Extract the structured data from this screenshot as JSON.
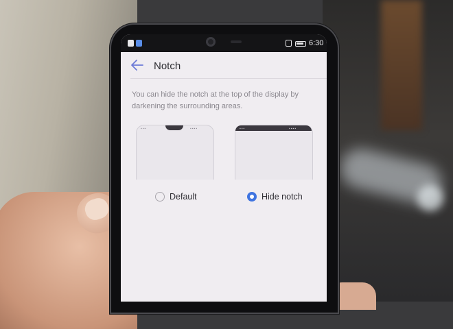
{
  "status_bar": {
    "time": "6:30"
  },
  "app_bar": {
    "title": "Notch",
    "back_icon": "arrow-left-icon"
  },
  "description": "You can hide the notch at the top of the display by darkening the surrounding areas.",
  "options": [
    {
      "label": "Default",
      "selected": false
    },
    {
      "label": "Hide notch",
      "selected": true
    }
  ],
  "colors": {
    "accent": "#3f74e0",
    "back_arrow": "#6c7ad6",
    "screen_bg": "#f0edf1"
  }
}
